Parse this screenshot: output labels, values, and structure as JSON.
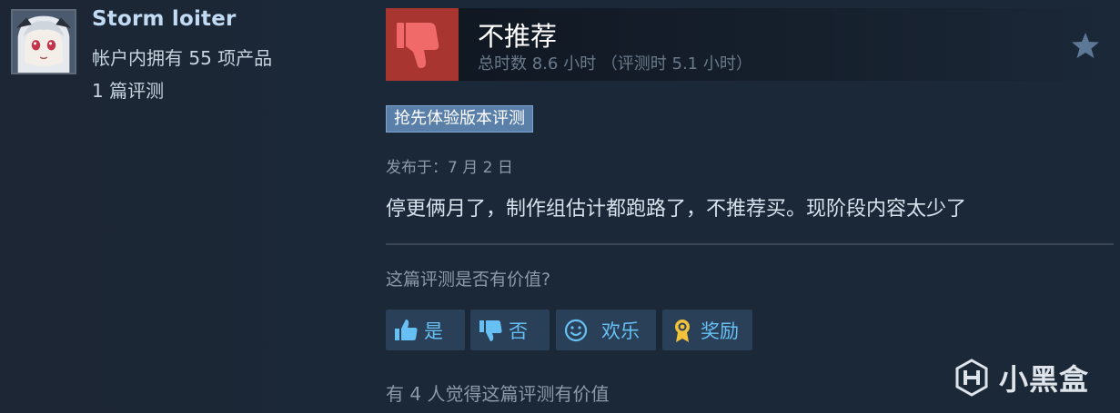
{
  "reviewer": {
    "username": "Storm loiter",
    "products_owned": "帐户内拥有 55 项产品",
    "review_count": "1 篇评测"
  },
  "review": {
    "verdict": "不推荐",
    "hours": "总时数 8.6 小时 （评测时 5.1 小时）",
    "early_access_badge": "抢先体验版本评测",
    "posted": "发布于：7 月 2 日",
    "text": "停更俩月了，制作组估计都跑路了，不推荐买。现阶段内容太少了",
    "verdict_icon": "thumbs-down-icon",
    "verdict_color": "#a8352f"
  },
  "feedback": {
    "question": "这篇评测是否有价值?",
    "yes_label": "是",
    "no_label": "否",
    "funny_label": "欢乐",
    "award_label": "奖励",
    "found_helpful": "有 4 人觉得这篇评测有价值"
  },
  "watermark": {
    "text": "小黑盒"
  },
  "colors": {
    "background": "#1b2838",
    "accent": "#66c0f4",
    "badge": "#5a7fa8"
  }
}
